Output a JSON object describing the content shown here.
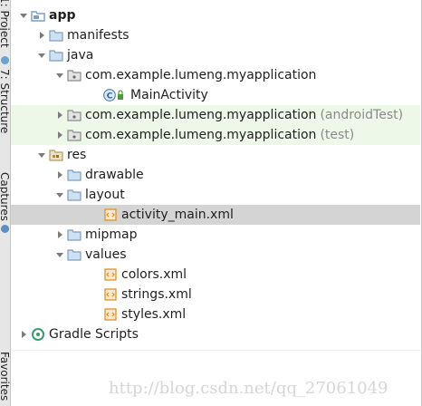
{
  "side_tabs": [
    {
      "label": "1: Project"
    },
    {
      "label": "7: Structure"
    },
    {
      "label": "Captures"
    },
    {
      "label": "Favorites"
    }
  ],
  "tree": [
    {
      "label": "app",
      "bold": true,
      "icon": "module-folder-icon",
      "expand": "expanded"
    },
    {
      "label": "manifests",
      "icon": "folder-icon",
      "expand": "collapsed"
    },
    {
      "label": "java",
      "icon": "folder-icon",
      "expand": "expanded"
    },
    {
      "label": "com.example.lumeng.myapplication",
      "icon": "package-icon",
      "expand": "expanded"
    },
    {
      "label": "MainActivity",
      "icon": "class-icon",
      "expand": "none"
    },
    {
      "label": "com.example.lumeng.myapplication",
      "suffix": "(androidTest)",
      "icon": "package-icon",
      "expand": "collapsed",
      "highlight": "green"
    },
    {
      "label": "com.example.lumeng.myapplication",
      "suffix": "(test)",
      "icon": "package-icon",
      "expand": "collapsed",
      "highlight": "green"
    },
    {
      "label": "res",
      "icon": "res-folder-icon",
      "expand": "expanded"
    },
    {
      "label": "drawable",
      "icon": "folder-icon",
      "expand": "collapsed"
    },
    {
      "label": "layout",
      "icon": "folder-icon",
      "expand": "expanded"
    },
    {
      "label": "activity_main.xml",
      "icon": "xml-file-icon",
      "expand": "none",
      "selected": true
    },
    {
      "label": "mipmap",
      "icon": "folder-icon",
      "expand": "collapsed"
    },
    {
      "label": "values",
      "icon": "folder-icon",
      "expand": "expanded"
    },
    {
      "label": "colors.xml",
      "icon": "xml-file-icon",
      "expand": "none"
    },
    {
      "label": "strings.xml",
      "icon": "xml-file-icon",
      "expand": "none"
    },
    {
      "label": "styles.xml",
      "icon": "xml-file-icon",
      "expand": "none"
    },
    {
      "label": "Gradle Scripts",
      "icon": "gradle-icon",
      "expand": "collapsed"
    }
  ],
  "watermark": "http://blog.csdn.net/qq_27061049",
  "colors": {
    "highlight_green": "#eef8e8",
    "selected_gray": "#d4d4d4",
    "folder_blue": "#7a9fc4",
    "xml_orange": "#e08a1e"
  }
}
